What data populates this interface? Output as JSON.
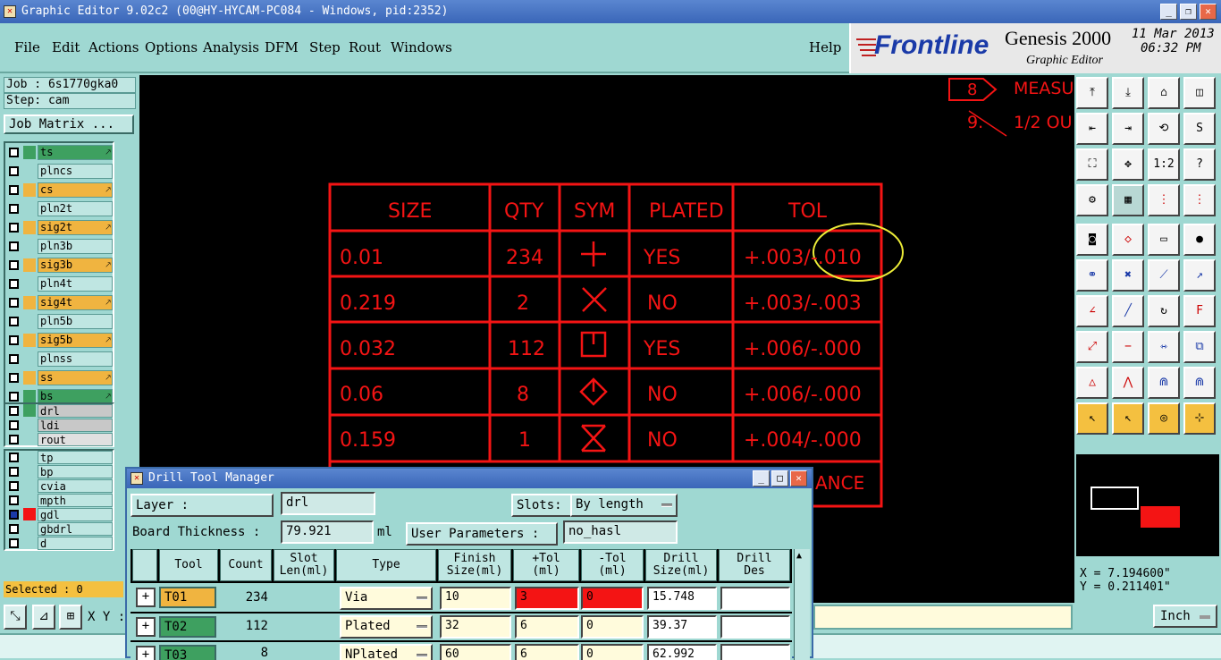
{
  "window": {
    "title": "Graphic Editor 9.02c2 (00@HY-HYCAM-PC084 - Windows, pid:2352)",
    "minimize": "_",
    "maximize": "❐",
    "close": "✕"
  },
  "menubar": {
    "items": [
      "File",
      "Edit",
      "Actions",
      "Options",
      "Analysis",
      "DFM",
      "Step",
      "Rout",
      "Windows"
    ],
    "help": "Help"
  },
  "logo": {
    "brand": "Frontline",
    "product": "Genesis 2000",
    "subtitle": "Graphic Editor",
    "date": "11 Mar 2013",
    "time": "06:32 PM"
  },
  "left": {
    "job": "Job : 6s1770gka0",
    "step": "Step: cam",
    "job_matrix": "Job Matrix ...",
    "layers_a": [
      "ts",
      "plncs",
      "cs",
      "pln2t",
      "sig2t",
      "pln3b",
      "sig3b",
      "pln4t",
      "sig4t",
      "pln5b",
      "sig5b",
      "plnss",
      "ss",
      "bs"
    ],
    "layers_b": [
      "drl",
      "ldi",
      "rout"
    ],
    "layers_c": [
      "tp",
      "bp",
      "cvia",
      "mpth",
      "gdl",
      "gbdrl",
      "d"
    ],
    "selected": "Selected : 0"
  },
  "canvas": {
    "tag_number": "8",
    "note_title": "MEASUR",
    "note_line_num": "9.",
    "note_line": "1/2 OU",
    "table_headers": [
      "SIZE",
      "QTY",
      "SYM",
      "PLATED",
      "TOL"
    ],
    "table_rows": [
      {
        "size": "0.01",
        "qty": "234",
        "plated": "YES",
        "tol": "+.003/-.010"
      },
      {
        "size": "0.219",
        "qty": "2",
        "plated": "NO",
        "tol": "+.003/-.003"
      },
      {
        "size": "0.032",
        "qty": "112",
        "plated": "YES",
        "tol": "+.006/-.000"
      },
      {
        "size": "0.06",
        "qty": "8",
        "plated": "NO",
        "tol": "+.006/-.000"
      },
      {
        "size": "0.159",
        "qty": "1",
        "plated": "NO",
        "tol": "+.004/-.000"
      }
    ],
    "footer_fragment": "ANCE"
  },
  "coords": {
    "x": "X = 7.194600\"",
    "y": "Y = 0.211401\""
  },
  "bottom": {
    "xy_label": "X Y :",
    "unit": "Inch"
  },
  "dialog": {
    "title": "Drill Tool Manager",
    "layer_label": "Layer          :",
    "layer_value": "drl",
    "slots_label": "Slots:",
    "slots_value": "By length",
    "thickness_label": "Board Thickness :",
    "thickness_value": "79.921",
    "thickness_unit": "ml",
    "user_params_label": "User Parameters :",
    "user_params_value": "no_hasl",
    "columns": [
      "Tool",
      "Count",
      "Slot\nLen(ml)",
      "Type",
      "Finish\nSize(ml)",
      "+Tol\n(ml)",
      "-Tol\n(ml)",
      "Drill\nSize(ml)",
      "Drill\nDes"
    ],
    "rows": [
      {
        "tool": "T01",
        "count": "234",
        "type": "Via",
        "finish": "10",
        "ptol": "3",
        "mtol": "0",
        "drill": "15.748"
      },
      {
        "tool": "T02",
        "count": "112",
        "type": "Plated",
        "finish": "32",
        "ptol": "6",
        "mtol": "0",
        "drill": "39.37"
      },
      {
        "tool": "T03",
        "count": "8",
        "type": "NPlated",
        "finish": "60",
        "ptol": "6",
        "mtol": "0",
        "drill": "62.992"
      }
    ]
  }
}
